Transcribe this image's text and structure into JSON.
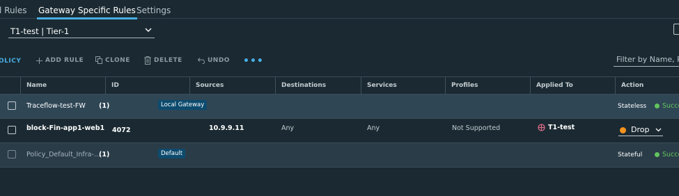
{
  "tabs": [
    {
      "label": "l Rules",
      "active": false
    },
    {
      "label": "Gateway Specific Rules",
      "active": true
    },
    {
      "label": "Settings",
      "active": false
    }
  ],
  "gateway_select": {
    "value": "T1-test | Tier-1"
  },
  "toolbar": {
    "add_policy": "OLICY",
    "add_rule": "ADD RULE",
    "clone": "CLONE",
    "delete": "DELETE",
    "undo": "UNDO",
    "more": "•••"
  },
  "filter": {
    "placeholder": "Filter by Name, Path and more"
  },
  "table": {
    "columns": [
      "Name",
      "ID",
      "Sources",
      "Destinations",
      "Services",
      "Profiles",
      "Applied To",
      "Action"
    ],
    "rows": [
      {
        "type": "policy",
        "name": "Traceflow-test-FW",
        "count": "(1)",
        "scope": "Local Gateway",
        "action": "Stateless",
        "status": "Success"
      },
      {
        "type": "rule",
        "name": "block-Fin-app1-web1",
        "id": "4072",
        "sources": "10.9.9.11",
        "destinations": "Any",
        "services": "Any",
        "profiles": "Not Supported",
        "applied_to": "T1-test",
        "action": "Drop"
      },
      {
        "type": "policy",
        "name": "Policy_Default_Infra-...",
        "count": "(1)",
        "scope": "Default",
        "action": "Stateful",
        "status": "Success"
      }
    ]
  },
  "colors": {
    "accent": "#49aee5",
    "success": "#62c45e",
    "drop": "#f6931d",
    "background": "#1b2a32"
  }
}
